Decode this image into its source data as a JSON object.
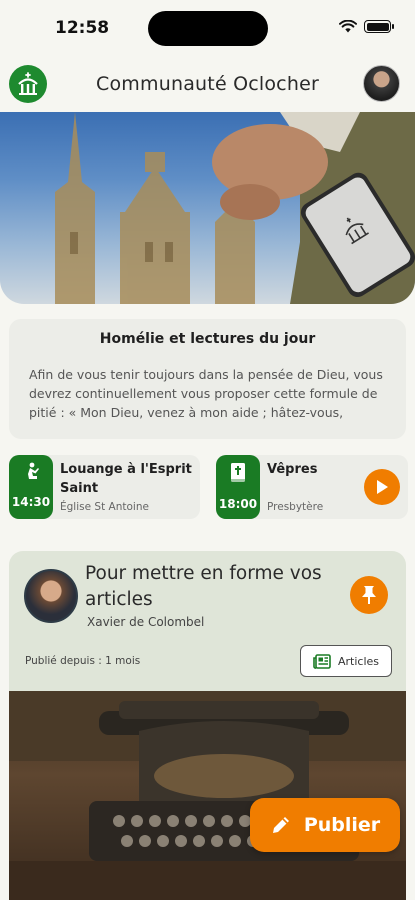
{
  "status_bar": {
    "time": "12:58",
    "battery_level": 1.0
  },
  "header": {
    "title": "Communauté Oclocher",
    "logo_icon": "church-icon",
    "avatar_icon": "user-avatar"
  },
  "homily": {
    "title": "Homélie et lectures du jour",
    "text": "Afin de vous tenir toujours dans la pensée de Dieu, vous devrez continuellement vous proposer cette formule de pitié : « Mon Dieu, venez à mon aide ; hâtez-vous, Seig..."
  },
  "events": [
    {
      "time": "14:30",
      "title": "Louange à l'Esprit Saint",
      "place": "Église St Antoine",
      "icon": "kneeling-prayer-icon"
    },
    {
      "time": "18:00",
      "title": "Vêpres",
      "place": "Presbytère",
      "icon": "bible-icon",
      "action_icon": "play-icon"
    }
  ],
  "post": {
    "title": "Pour mettre en forme vos articles",
    "author": "Xavier de Colombel",
    "published": "Publié depuis : 1 mois",
    "articles_label": "Articles",
    "pin_icon": "pin-icon",
    "articles_icon": "newspaper-icon"
  },
  "publish": {
    "label": "Publier",
    "icon": "pencil-icon"
  },
  "colors": {
    "brand_green": "#1a7b24",
    "accent_orange": "#f07d00",
    "background": "#f6f6f1"
  }
}
